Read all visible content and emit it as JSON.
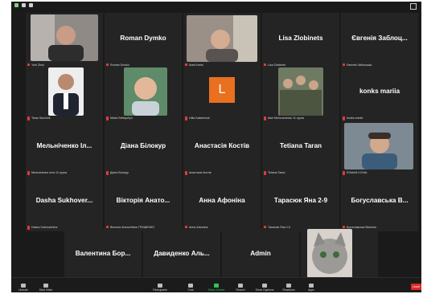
{
  "tiles": [
    {
      "name": "",
      "label": "Yurii Zhuk"
    },
    {
      "name": "Roman Dymko",
      "label": "Roman Dymko"
    },
    {
      "name": "",
      "label": "Ilyas Karim"
    },
    {
      "name": "Lisa Zlobinets",
      "label": "Lisa Zlobinets"
    },
    {
      "name": "Євгенія Заблоц...",
      "label": "Євгенія Заблоцька"
    },
    {
      "name": "",
      "label": "Taras Savchuk"
    },
    {
      "name": "",
      "label": "Marta Stetsyshyn"
    },
    {
      "name": "L",
      "label": "Lillia Kalachniuk"
    },
    {
      "name": "",
      "label": "Іван Мельниченко 11 група"
    },
    {
      "name": "konks mariia",
      "label": "konks mariia"
    },
    {
      "name": "Мельніченко Іл...",
      "label": "Мельніченко Ілля 11 група"
    },
    {
      "name": "Діана Білокур",
      "label": "Діана Білокур"
    },
    {
      "name": "Анастасія Костів",
      "label": "Анастасія Костів"
    },
    {
      "name": "Tetiana Taran",
      "label": "Tetiana Taran"
    },
    {
      "name": "",
      "label": "ROMAN KOVAL"
    },
    {
      "name": "Dasha Sukhover...",
      "label": "Dasha Sukhoverkha"
    },
    {
      "name": "Вікторія Анато...",
      "label": "Вікторія Анатоліївна ГРИЩЕНКО"
    },
    {
      "name": "Анна Афоніна",
      "label": "Анна Афоніна"
    },
    {
      "name": "Тарасюк Яна 2-9",
      "label": "Тарасюк Яна 2-9"
    },
    {
      "name": "Богуславська В...",
      "label": "Богуславська Валерія"
    },
    {
      "name": "Валентина Бор...",
      "label": "Валентина Бородина"
    },
    {
      "name": "Давиденко Аль...",
      "label": "Давиденко Альона"
    },
    {
      "name": "Admin",
      "label": "Admin"
    },
    {
      "name": "",
      "label": "Olha Vasyunyk"
    }
  ],
  "toolbar": {
    "unmute": "Unmute",
    "start_video": "Start Video",
    "participants": "Participants",
    "chat": "Chat",
    "share_screen": "Share Screen",
    "record": "Record",
    "show_captions": "Show Captions",
    "reactions": "Reactions",
    "apps": "Apps",
    "leave": "Leave"
  },
  "colors": {
    "background": "#1a1a1a",
    "tile": "#242424",
    "muted_icon": "#e23b3b",
    "share_screen": "#36c05a",
    "avatar_orange": "#e8701f",
    "leave": "#e02828"
  }
}
